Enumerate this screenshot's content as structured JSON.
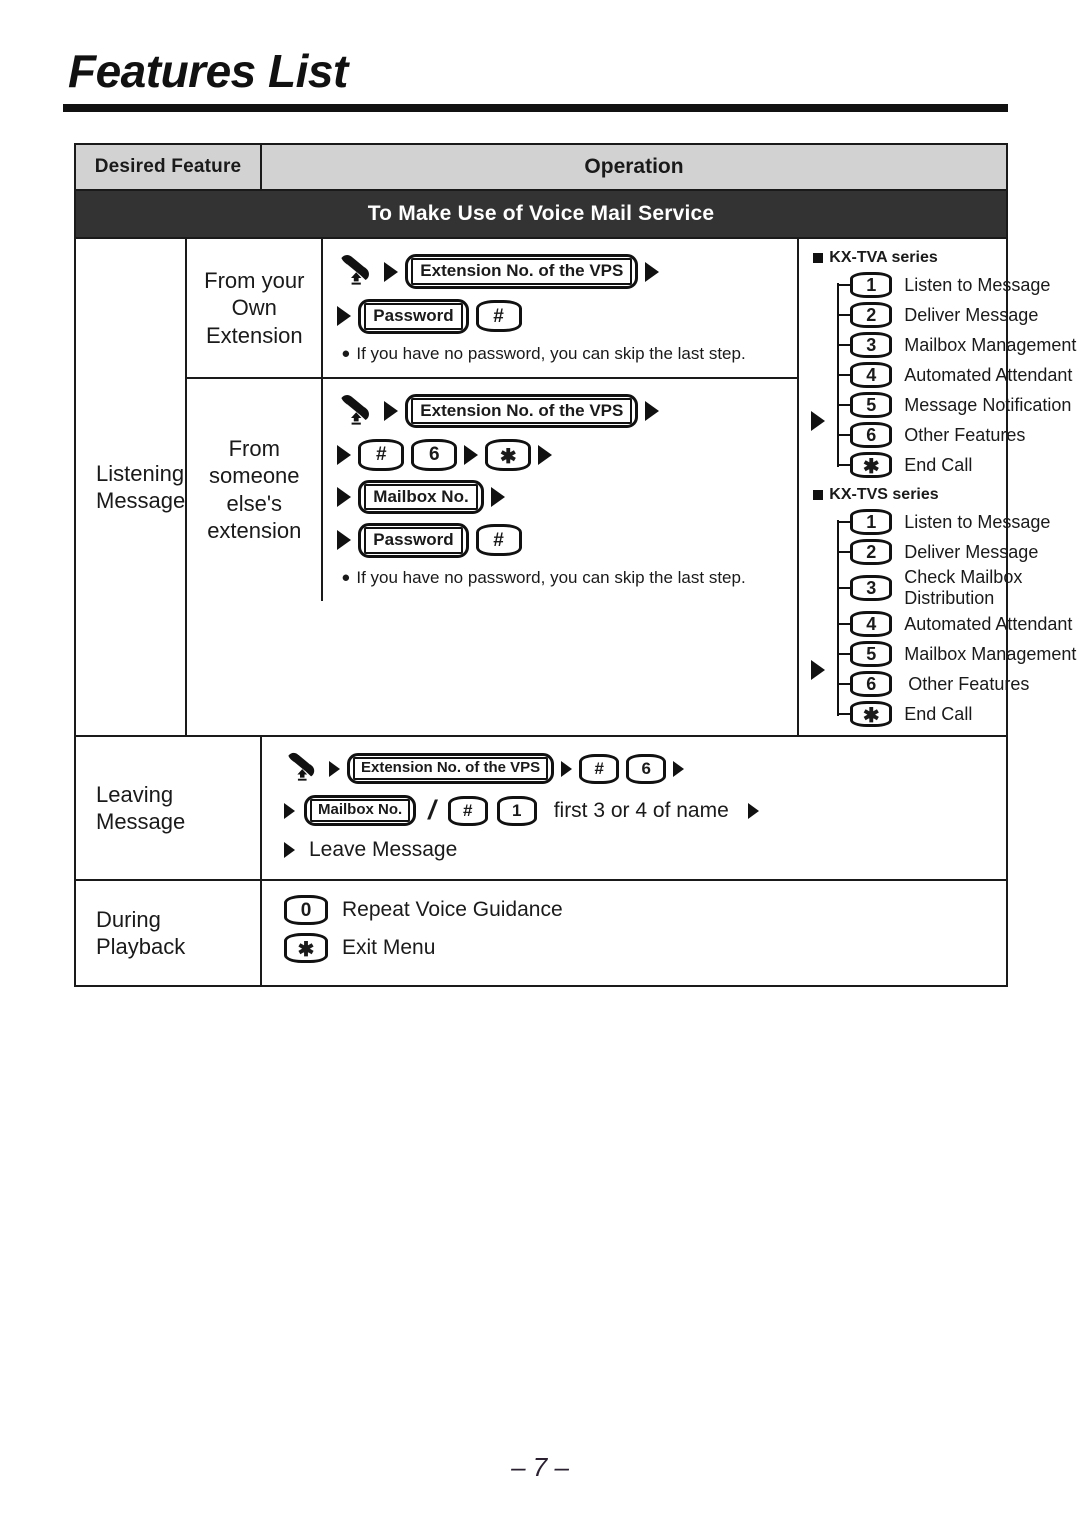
{
  "page": {
    "title": "Features List",
    "folio": "– 7 –"
  },
  "table": {
    "header": {
      "feature": "Desired Feature",
      "operation": "Operation"
    },
    "section": "To Make Use of Voice Mail Service",
    "rows": [
      {
        "feature": "Listening\nMessage",
        "sub_rows": [
          {
            "label": "From your\nOwn\nExtension",
            "steps": [
              [
                "handset-icon",
                "arrow",
                "pill:Extension No. of the VPS",
                "arrow"
              ],
              [
                "arrow",
                "pill:Password",
                "key:#"
              ]
            ],
            "note": "If you have no password, you can skip the last step."
          },
          {
            "label": "From\nsomeone\nelse's\nextension",
            "steps": [
              [
                "handset-icon",
                "arrow",
                "pill:Extension No. of the VPS",
                "arrow"
              ],
              [
                "arrow",
                "key:#",
                "key:6",
                "arrow",
                "key:*",
                "arrow"
              ],
              [
                "arrow",
                "pill:Mailbox No.",
                "arrow"
              ],
              [
                "arrow",
                "pill:Password",
                "key:#"
              ]
            ],
            "note": "If you have no password, you can skip the last step."
          }
        ],
        "menus": [
          {
            "title": "KX-TVA series",
            "pointer_index": 3,
            "items": [
              {
                "key": "1",
                "label": "Listen to Message"
              },
              {
                "key": "2",
                "label": "Deliver Message"
              },
              {
                "key": "3",
                "label": "Mailbox Management"
              },
              {
                "key": "4",
                "label": "Automated Attendant"
              },
              {
                "key": "5",
                "label": "Message Notification"
              },
              {
                "key": "6",
                "label": "Other Features"
              },
              {
                "key": "*",
                "label": "End Call"
              }
            ]
          },
          {
            "title": "KX-TVS series",
            "pointer_index": 3,
            "items": [
              {
                "key": "1",
                "label": "Listen to Message"
              },
              {
                "key": "2",
                "label": "Deliver Message"
              },
              {
                "key": "3",
                "label": "Check Mailbox Distribution"
              },
              {
                "key": "4",
                "label": "Automated Attendant"
              },
              {
                "key": "5",
                "label": "Mailbox Management"
              },
              {
                "key": "6",
                "label": "Other Features"
              },
              {
                "key": "*",
                "label": "End Call"
              }
            ]
          }
        ]
      },
      {
        "feature": "Leaving\nMessage",
        "steps": [
          [
            "handset-icon",
            "arrow",
            "pill:Extension No. of the VPS",
            "arrow",
            "key:#",
            "key:6",
            "arrow"
          ],
          [
            "arrow",
            "pill:Mailbox No.",
            "slash:/",
            "key:#",
            "key:1",
            "text:first 3 or 4 of name",
            "arrow"
          ],
          [
            "arrow",
            "text:Leave Message"
          ]
        ]
      },
      {
        "feature": "During\nPlayback",
        "lines": [
          {
            "key": "0",
            "label": "Repeat Voice Guidance"
          },
          {
            "key": "*",
            "label": "Exit Menu"
          }
        ]
      }
    ]
  },
  "labels": {
    "extension_no_vps": "Extension No. of the VPS",
    "password": "Password",
    "mailbox_no": "Mailbox No.",
    "first_3_or_4": "first 3 or 4 of name",
    "leave_message": "Leave Message",
    "hash": "#",
    "star": "✱",
    "six": "6",
    "one": "1",
    "zero": "0",
    "slash": "/",
    "note_no_password": "If you have no password, you can skip the last step."
  },
  "colors": {
    "header_fill": "#d2d2d2",
    "section_fill": "#333333",
    "ink": "#1a1a1a"
  }
}
